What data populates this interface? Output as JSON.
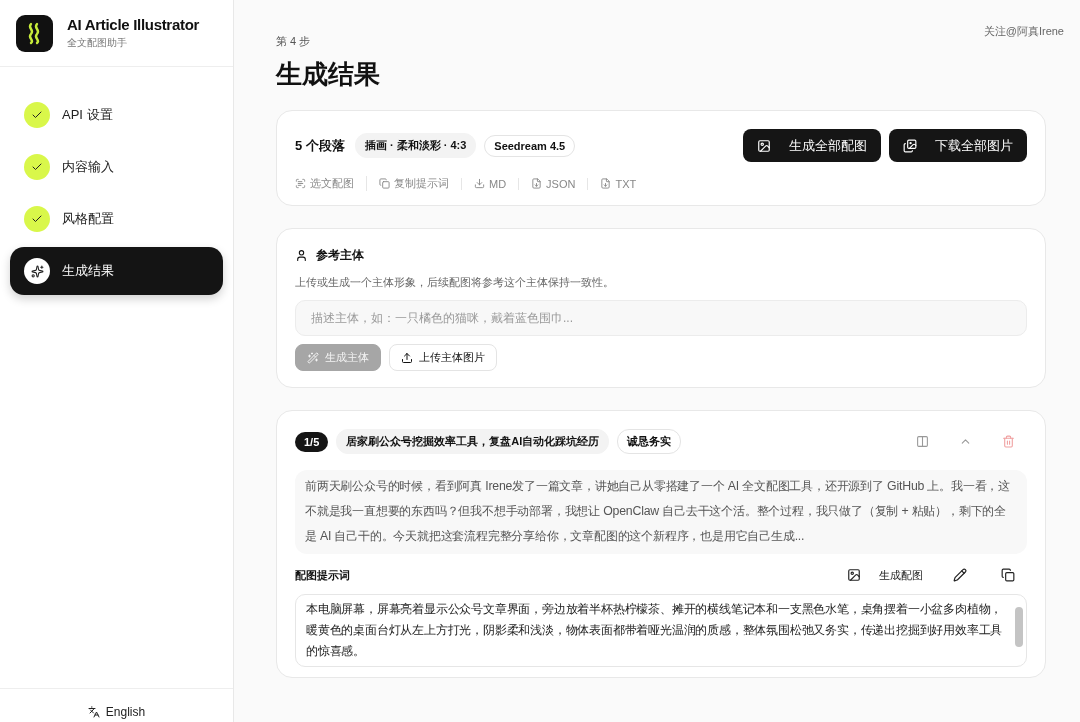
{
  "brand": {
    "name": "AI Article Illustrator",
    "subtitle": "全文配图助手"
  },
  "steps": [
    {
      "label": "API 设置",
      "kind": "done",
      "selected": false
    },
    {
      "label": "内容输入",
      "kind": "done",
      "selected": false
    },
    {
      "label": "风格配置",
      "kind": "done",
      "selected": false
    },
    {
      "label": "生成结果",
      "kind": "current",
      "selected": true
    }
  ],
  "language": "English",
  "follow": "关注@阿真Irene",
  "step_label": "第 4 步",
  "title": "生成结果",
  "summary": {
    "count": "5 个段落",
    "tags": [
      {
        "label": "插画 · 柔和淡彩 · 4:3",
        "kind": "filled"
      },
      {
        "label": "Seedream 4.5",
        "kind": "outline"
      }
    ],
    "buttons": [
      {
        "label": "生成全部配图",
        "kind": "image"
      },
      {
        "label": "下载全部图片",
        "kind": "images"
      }
    ],
    "actions": [
      {
        "label": "选文配图",
        "kind": "select"
      },
      {
        "label": "复制提示词",
        "kind": "copy"
      },
      {
        "label": "MD",
        "kind": "download"
      },
      {
        "label": "JSON",
        "kind": "file"
      },
      {
        "label": "TXT",
        "kind": "file"
      }
    ]
  },
  "subject": {
    "title": "参考主体",
    "hint": "上传或生成一个主体形象，后续配图将参考这个主体保持一致性。",
    "placeholder": "描述主体，如：一只橘色的猫咪，戴着蓝色围巾...",
    "buttons": [
      {
        "label": "生成主体",
        "kind": "wand",
        "disabled": true
      },
      {
        "label": "上传主体图片",
        "kind": "upload",
        "disabled": false
      }
    ]
  },
  "paragraph": {
    "index": "1/5",
    "heading": "居家刷公众号挖掘效率工具，复盘AI自动化踩坑经历",
    "tone": "诚恳务实",
    "text": "前两天刷公众号的时候，看到阿真 Irene发了一篇文章，讲她自己从零搭建了一个 AI 全文配图工具，还开源到了 GitHub 上。我一看，这不就是我一直想要的东西吗？但我不想手动部署，我想让 OpenClaw 自己去干这个活。整个过程，我只做了（复制 + 粘贴），剩下的全是 AI 自己干的。今天就把这套流程完整分享给你，文章配图的这个新程序，也是用它自己生成...",
    "prompt_label": "配图提示词",
    "generate": "生成配图",
    "prompt": "本电脑屏幕，屏幕亮着显示公众号文章界面，旁边放着半杯热柠檬茶、摊开的横线笔记本和一支黑色水笔，桌角摆着一小盆多肉植物，暖黄色的桌面台灯从左上方打光，阴影柔和浅淡，物体表面都带着哑光温润的质感，整体氛围松弛又务实，传递出挖掘到好用效率工具的惊喜感。"
  }
}
